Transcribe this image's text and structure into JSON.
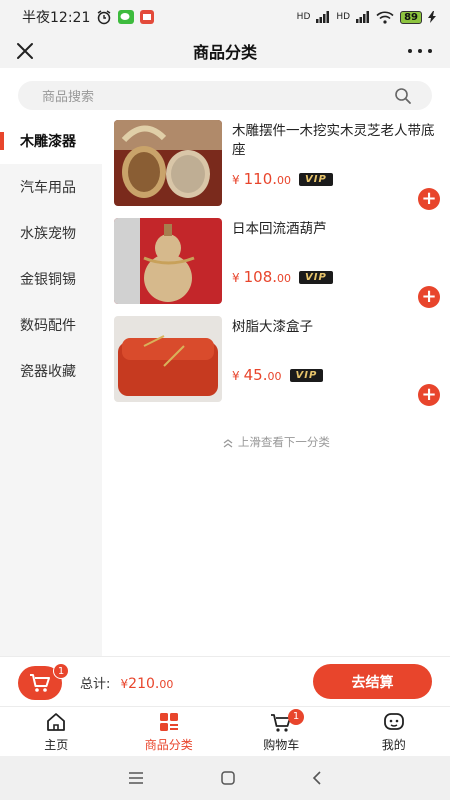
{
  "status_bar": {
    "time_text": "半夜12:21",
    "battery": "89",
    "signal_1": "HD",
    "signal_2": "HD"
  },
  "nav": {
    "title": "商品分类"
  },
  "search": {
    "placeholder": "商品搜索"
  },
  "sidebar": {
    "items": [
      {
        "label": "木雕漆器",
        "active": true
      },
      {
        "label": "汽车用品"
      },
      {
        "label": "水族宠物"
      },
      {
        "label": "金银铜锡"
      },
      {
        "label": "数码配件"
      },
      {
        "label": "瓷器收藏"
      }
    ]
  },
  "products": [
    {
      "name": "木雕摆件一木挖实木灵芝老人带底座",
      "currency": "¥",
      "price_int": "110.",
      "price_dec": "00",
      "vip": "VIP"
    },
    {
      "name": "日本回流酒葫芦",
      "currency": "¥",
      "price_int": "108.",
      "price_dec": "00",
      "vip": "VIP"
    },
    {
      "name": "树脂大漆盒子",
      "currency": "¥",
      "price_int": "45.",
      "price_dec": "00",
      "vip": "VIP"
    }
  ],
  "next_hint": "上滑查看下一分类",
  "cart_bar": {
    "badge": "1",
    "total_label": "总计:",
    "currency": "¥",
    "total_int": "210.",
    "total_dec": "00",
    "checkout_label": "去结算"
  },
  "tabbar": {
    "items": [
      {
        "label": "主页",
        "icon": "home-icon"
      },
      {
        "label": "商品分类",
        "icon": "category-icon",
        "active": true
      },
      {
        "label": "购物车",
        "icon": "cart-icon",
        "badge": "1"
      },
      {
        "label": "我的",
        "icon": "profile-icon"
      }
    ]
  },
  "colors": {
    "accent": "#e8452c",
    "vip_bg": "#1b1b1b",
    "vip_text": "#e7c46b"
  }
}
